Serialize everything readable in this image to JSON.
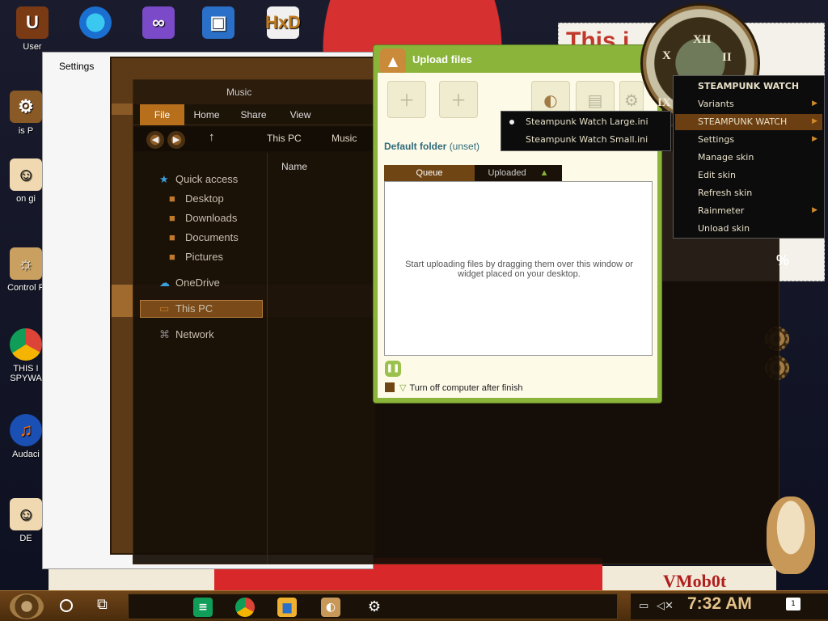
{
  "desktop": {
    "icons": [
      {
        "label": "User",
        "icon": "user-folder-icon"
      },
      {
        "label": "is P",
        "icon": "this-pc-icon"
      },
      {
        "label": "on gi",
        "icon": "person-icon"
      },
      {
        "label": "Control P",
        "icon": "control-panel-icon"
      },
      {
        "label": "THIS I",
        "sub": "SPYWA",
        "icon": "chrome-icon"
      },
      {
        "label": "Audaci",
        "icon": "audacity-icon"
      },
      {
        "label": "DE",
        "icon": "person-icon"
      }
    ],
    "top_icons": [
      "edge-icon",
      "visual-studio-icon",
      "virtualbox-icon",
      "hxd-icon"
    ],
    "wallpaper_text": "This i",
    "sign_text": "VMob0t",
    "percent": "%"
  },
  "settings_window": {
    "title": "Settings"
  },
  "explorer": {
    "title": "Music",
    "ribbon_tabs": [
      "File",
      "Home",
      "Share",
      "View"
    ],
    "address": [
      "This PC",
      "Music"
    ],
    "column_header": "Name",
    "nav": {
      "quick_access": "Quick access",
      "desktop": "Desktop",
      "downloads": "Downloads",
      "documents": "Documents",
      "pictures": "Pictures",
      "onedrive": "OneDrive",
      "this_pc": "This PC",
      "network": "Network"
    }
  },
  "upload": {
    "title": "Upload files",
    "default_folder_label": "Default folder",
    "default_folder_value": "(unset)",
    "tabs": [
      "Queue",
      "Uploaded"
    ],
    "drop_text": "Start uploading files by dragging them over this window or widget placed on your desktop.",
    "shutdown_label": "Turn off computer after finish"
  },
  "submenu": {
    "items": [
      "Steampunk Watch Large.ini",
      "Steampunk Watch Small.ini"
    ]
  },
  "context_menu": {
    "title": "STEAMPUNK WATCH",
    "items": [
      "Variants",
      "STEAMPUNK WATCH",
      "Settings",
      "Manage skin",
      "Edit skin",
      "Refresh skin",
      "Rainmeter",
      "Unload skin"
    ]
  },
  "watch": {
    "numerals": [
      "XII",
      "II",
      "X",
      "IX"
    ]
  },
  "taskbar": {
    "time": "7:32 AM",
    "notification_count": "1",
    "accent": "#6e4418"
  }
}
